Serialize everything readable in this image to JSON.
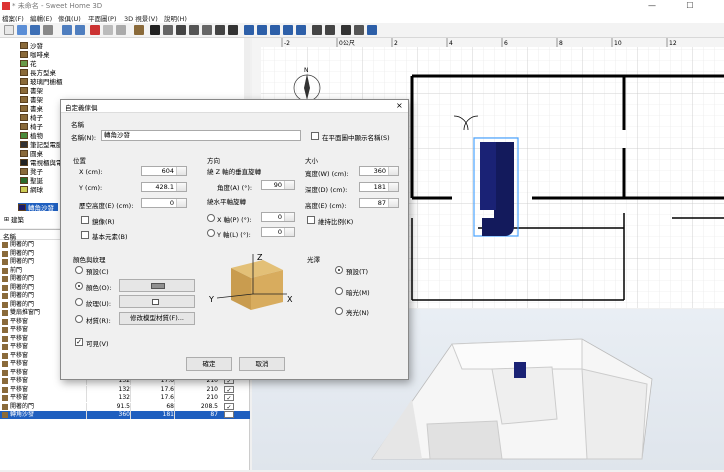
{
  "window": {
    "title": "* 未命名 - Sweet Home 3D",
    "minimize": "—",
    "maximize": "☐"
  },
  "menu": [
    "檔案(F)",
    "編輯(E)",
    "傢俱(U)",
    "平面圖(P)",
    "3D 視景(V)",
    "說明(H)"
  ],
  "tree": [
    "沙發",
    "咖啡桌",
    "花",
    "長方型桌",
    "玻璃門櫥櫃",
    "書架",
    "書架",
    "書桌",
    "椅子",
    "椅子",
    "植物",
    "筆記型電腦",
    "圓桌",
    "電視櫃與電視",
    "凳子",
    "聖誕",
    "網球",
    "轉角沙發",
    "建築"
  ],
  "list": {
    "header": "名稱",
    "rows": [
      {
        "n": "開著的門"
      },
      {
        "n": "開著的門"
      },
      {
        "n": "開著的門"
      },
      {
        "n": "前門"
      },
      {
        "n": "開著的門"
      },
      {
        "n": "開著的門"
      },
      {
        "n": "開著的門"
      },
      {
        "n": "開著的門"
      },
      {
        "n": "雙扇推窗門"
      },
      {
        "n": "平移窗"
      },
      {
        "n": "平移窗"
      },
      {
        "n": "平移窗"
      },
      {
        "n": "平移窗"
      },
      {
        "n": "平移窗"
      },
      {
        "n": "平移窗",
        "w": "132",
        "d": "17.6",
        "h": "210"
      },
      {
        "n": "平移窗",
        "w": "132",
        "d": "17.6",
        "h": "210"
      },
      {
        "n": "平移窗",
        "w": "132",
        "d": "17.6",
        "h": "210"
      },
      {
        "n": "平移窗",
        "w": "132",
        "d": "17.6",
        "h": "210"
      },
      {
        "n": "平移窗",
        "w": "132",
        "d": "17.6",
        "h": "210"
      },
      {
        "n": "開著的門",
        "w": "91.5",
        "d": "68",
        "h": "208.5"
      },
      {
        "n": "轉角沙發",
        "w": "360",
        "d": "181",
        "h": "87",
        "selected": true
      }
    ]
  },
  "ruler": {
    "ticks": [
      "-2",
      "0公尺",
      "2",
      "4",
      "6",
      "8",
      "10",
      "12"
    ]
  },
  "dialog": {
    "title": "自定義傢俱",
    "close": "×",
    "name_group": "名稱",
    "name_label": "名稱(N):",
    "name_value": "轉角沙發",
    "show_name_label": "在平面圖中顯示名稱(S)",
    "position": {
      "title": "位置",
      "x_label": "X (cm):",
      "x": "604",
      "y_label": "Y (cm):",
      "y": "428.1",
      "elev_label": "歷空高度(E) (cm):",
      "elev": "0",
      "mirror": "鏡像(R)",
      "base": "基本元素(B)"
    },
    "orientation": {
      "title": "方向",
      "vert_label": "繞 Z 軸的垂直旋轉",
      "angle_label": "角度(A) (°):",
      "angle": "90",
      "horiz_label": "繞水平軸旋轉",
      "xaxis_label": "X 軸(P) (°):",
      "xaxis": "0",
      "yaxis_label": "Y 軸(L) (°):",
      "yaxis": "0"
    },
    "size": {
      "title": "大小",
      "w_label": "寬度(W) (cm):",
      "w": "360",
      "d_label": "深度(D) (cm):",
      "d": "181",
      "h_label": "高度(E) (cm):",
      "h": "87",
      "keep": "維持比例(K)"
    },
    "color": {
      "title": "顏色與紋理",
      "default": "預設(C)",
      "color": "顏色(O):",
      "texture": "紋理(U):",
      "material": "材質(R):",
      "modify": "修改模型材質(F)...",
      "swatch": "#909090"
    },
    "shininess": {
      "title": "光澤",
      "default": "預設(T)",
      "matt": "暗光(M)",
      "shiny": "亮光(N)"
    },
    "visible": "可見(V)",
    "ok": "確定",
    "cancel": "取消",
    "axis_z": "Z",
    "axis_y": "Y",
    "axis_x": "X"
  }
}
